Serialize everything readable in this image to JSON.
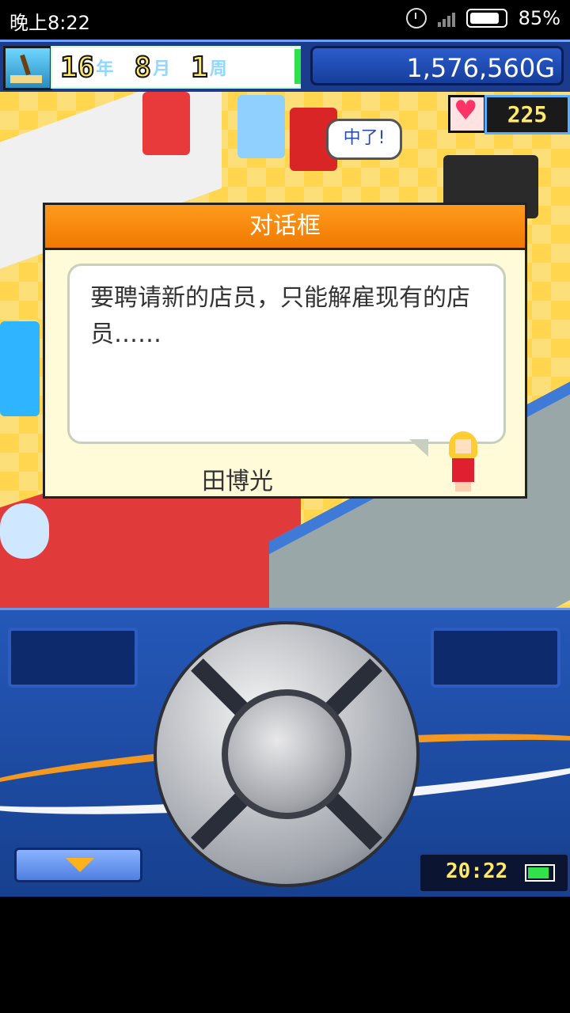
{
  "status_bar": {
    "time": "晚上8:22",
    "battery_percent": "85%",
    "icons": [
      "alarm-icon",
      "signal-icon",
      "battery-icon"
    ]
  },
  "hud": {
    "year_value": "16",
    "year_unit": "年",
    "month_value": "8",
    "month_unit": "月",
    "week_value": "1",
    "week_unit": "周",
    "money": "1,576,560G",
    "hearts": "225"
  },
  "scene": {
    "speech_bubble": "中了!"
  },
  "dialog": {
    "title": "对话框",
    "message": "要聘请新的店员，只能解雇现有的店员……",
    "speaker": "田博光"
  },
  "controller": {
    "clock": "20:22"
  },
  "colors": {
    "dialog_header": "#f07a00",
    "controller_bg": "#2458b8",
    "money_panel": "#163d9b"
  }
}
